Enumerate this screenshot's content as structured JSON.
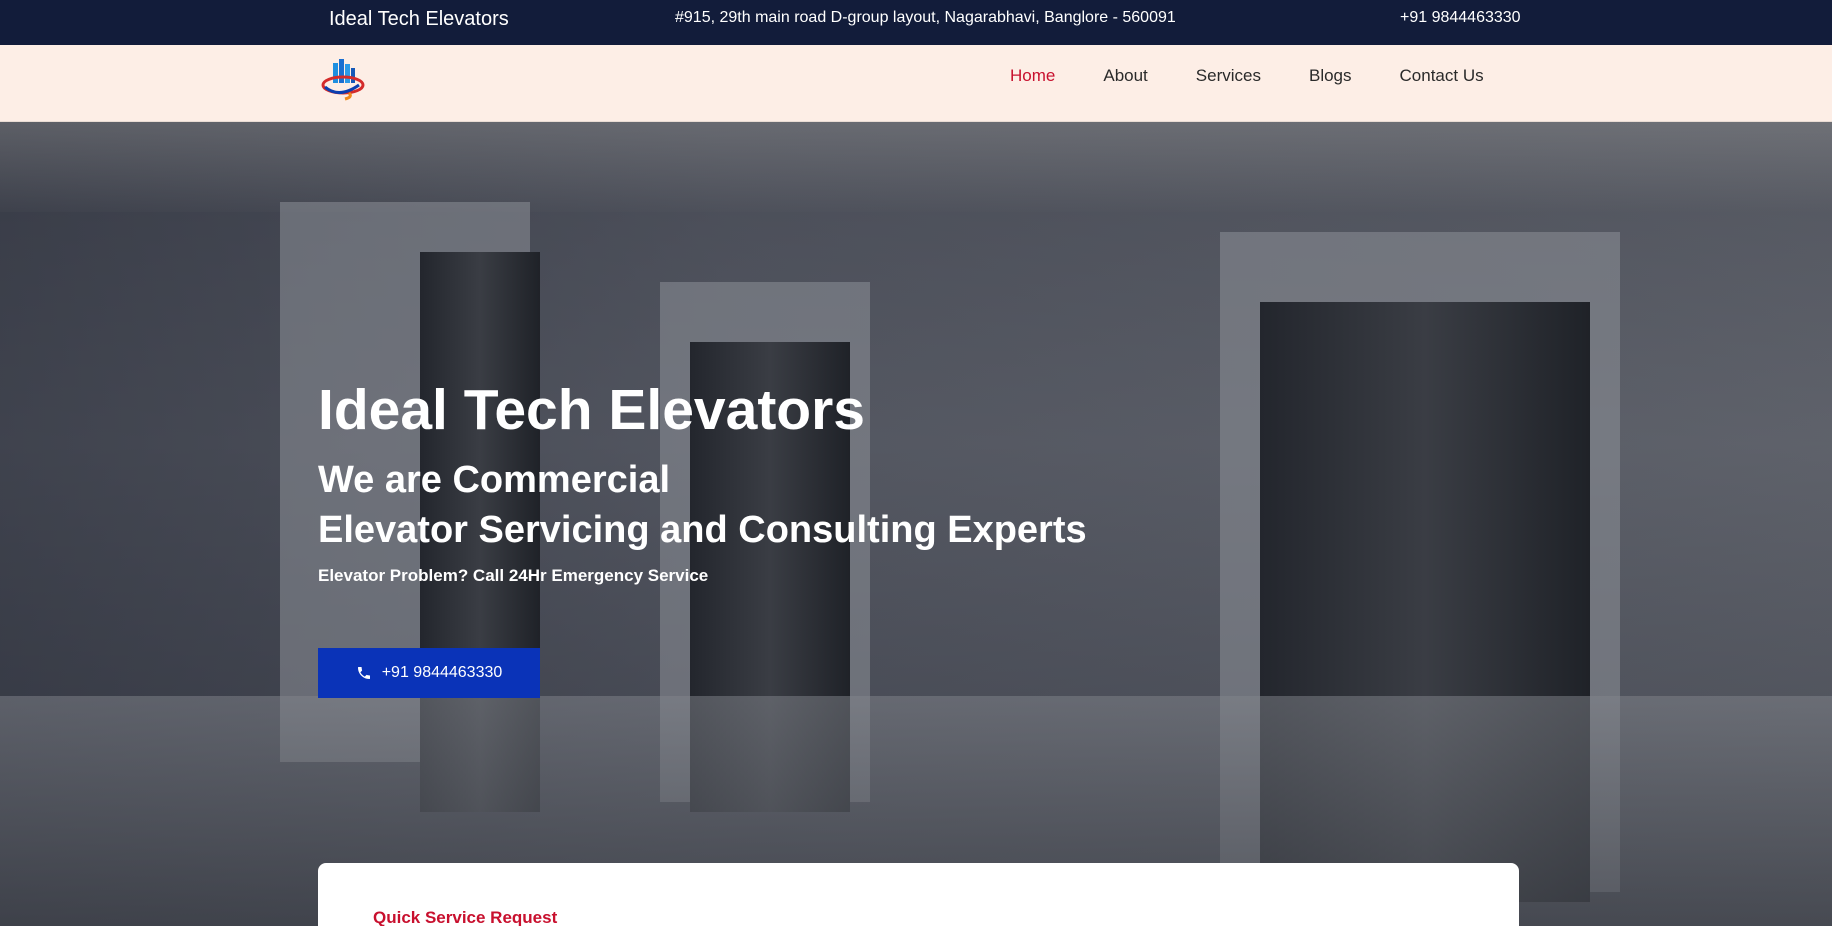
{
  "topbar": {
    "brand": "Ideal Tech Elevators",
    "address": "#915, 29th main road D-group layout, Nagarabhavi, Banglore - 560091",
    "phone": "+91 9844463330"
  },
  "nav": {
    "items": [
      {
        "label": "Home",
        "active": true
      },
      {
        "label": "About"
      },
      {
        "label": "Services"
      },
      {
        "label": "Blogs"
      },
      {
        "label": "Contact Us"
      }
    ]
  },
  "hero": {
    "title": "Ideal Tech Elevators",
    "subtitle_line1": "We are Commercial",
    "subtitle_line2": "Elevator Servicing and Consulting Experts",
    "note": "Elevator Problem? Call 24Hr Emergency Service",
    "cta_label": "+91 9844463330"
  },
  "card": {
    "label": "Quick Service Request"
  },
  "colors": {
    "topbar": "#121c3a",
    "navbar": "#fdeee6",
    "accent_red": "#c8102e",
    "cta_blue": "#0a33b8"
  },
  "icons": {
    "logo": "company-logo",
    "phone": "phone-icon"
  }
}
